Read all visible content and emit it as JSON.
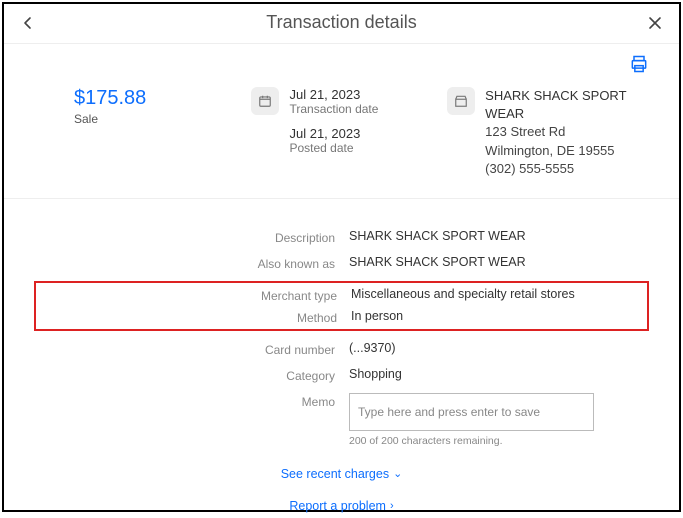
{
  "header": {
    "title": "Transaction details"
  },
  "summary": {
    "amount": "$175.88",
    "type": "Sale",
    "transaction_date": "Jul 21, 2023",
    "transaction_date_label": "Transaction date",
    "posted_date": "Jul 21, 2023",
    "posted_date_label": "Posted date",
    "merchant_name": "SHARK SHACK SPORT WEAR",
    "merchant_addr1": "123 Street Rd",
    "merchant_addr2": "Wilmington, DE 19555",
    "merchant_phone": "(302) 555-5555"
  },
  "details": {
    "description_label": "Description",
    "description_value": "SHARK SHACK SPORT WEAR",
    "aka_label": "Also known as",
    "aka_value": "SHARK SHACK SPORT WEAR",
    "merchant_type_label": "Merchant type",
    "merchant_type_value": "Miscellaneous and specialty retail stores",
    "method_label": "Method",
    "method_value": "In person",
    "card_label": "Card number",
    "card_value": "(...9370)",
    "category_label": "Category",
    "category_value": "Shopping",
    "memo_label": "Memo",
    "memo_placeholder": "Type here and press enter to save",
    "memo_hint": "200 of 200 characters remaining."
  },
  "links": {
    "recent_charges": "See recent charges",
    "report_problem": "Report a problem"
  }
}
